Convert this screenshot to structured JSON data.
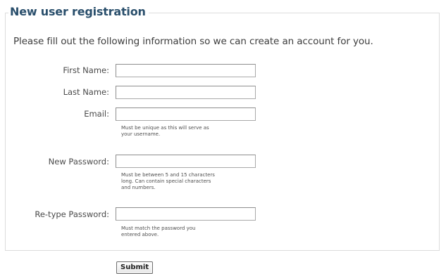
{
  "form": {
    "title": "New user registration",
    "intro": "Please fill out the following information so we can create an account for you.",
    "fields": {
      "first_name": {
        "label": "First Name:",
        "value": ""
      },
      "last_name": {
        "label": "Last Name:",
        "value": ""
      },
      "email": {
        "label": "Email:",
        "value": "",
        "hint_line1": "Must be unique as this will serve as",
        "hint_line2": "your username."
      },
      "new_password": {
        "label": "New Password:",
        "value": "",
        "hint_line1": "Must be between 5 and 15 characters",
        "hint_line2": "long. Can contain special characters",
        "hint_line3": "and numbers."
      },
      "retype_password": {
        "label": "Re-type Password:",
        "value": "",
        "hint_line1": "Must match the password you",
        "hint_line2": "entered above."
      }
    },
    "submit_label": "Submit"
  },
  "colors": {
    "title": "#2a4f6c",
    "fieldset_border": "#dcdcdc",
    "text": "#4a4a4a"
  }
}
